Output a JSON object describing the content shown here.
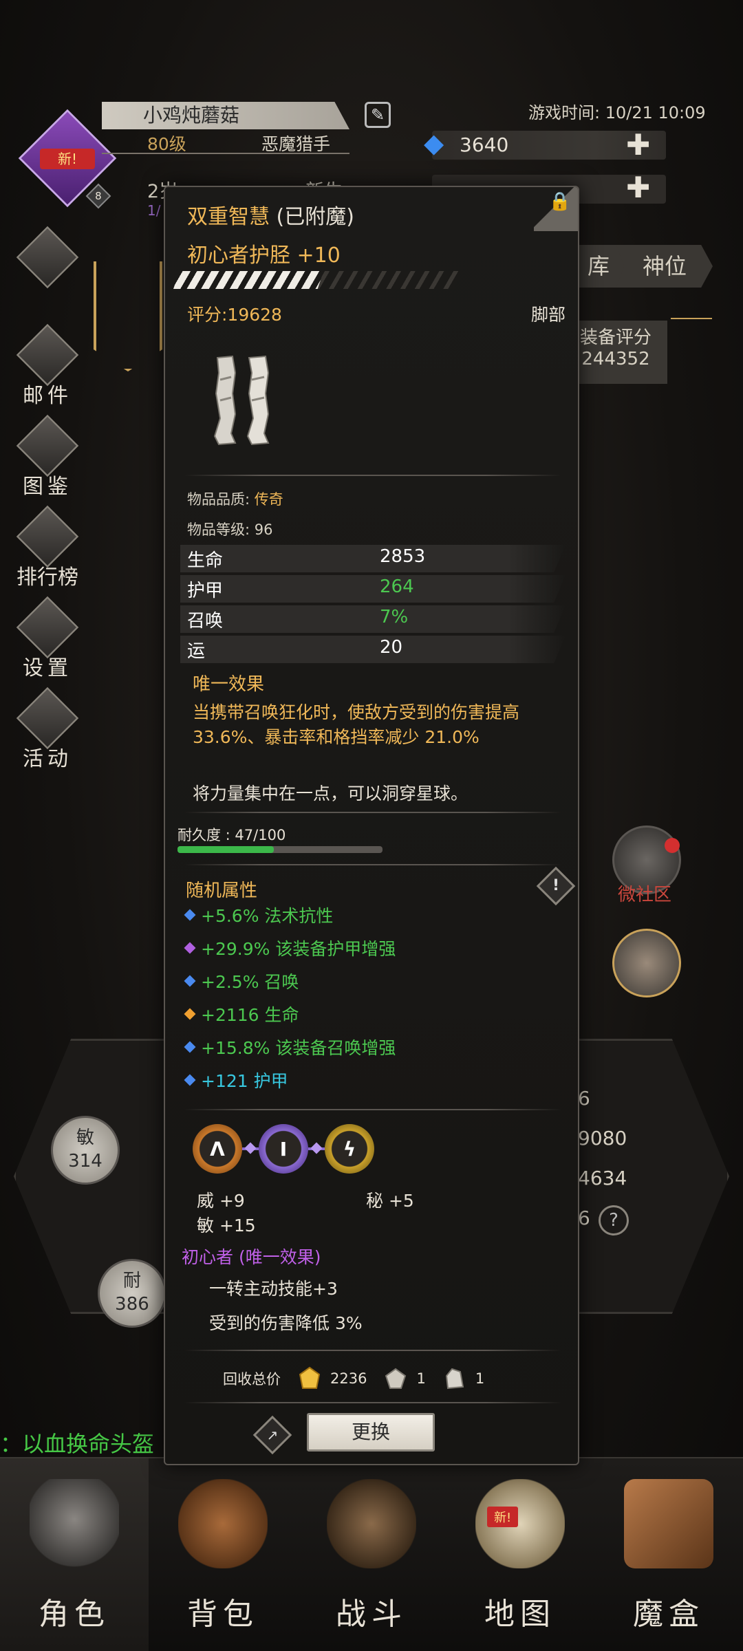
{
  "player": {
    "name": "小鸡炖蘑菇",
    "level": "80级",
    "class_name": "恶魔猎手",
    "row2_left": "2岁",
    "row2_right": "新生",
    "row2_sub": "1/",
    "avatar_badge": "新!",
    "avatar_level": "8"
  },
  "header": {
    "game_time": "游戏时间: 10/21 10:09",
    "gem_count": "3640"
  },
  "side_menu": [
    {
      "label": "邮件"
    },
    {
      "label": "图鉴"
    },
    {
      "label": "排行榜"
    },
    {
      "label": "设置"
    },
    {
      "label": "活动"
    }
  ],
  "tabs": {
    "warehouse": "库",
    "divine": "神位"
  },
  "equip_score": {
    "label": "装备评分",
    "value": "244352"
  },
  "stats_bg": {
    "agi": {
      "label": "敏",
      "value": "314"
    },
    "end": {
      "label": "耐",
      "value": "386"
    },
    "right_values": [
      "6",
      "9080",
      "4634",
      "6"
    ]
  },
  "social": {
    "label": "微社区"
  },
  "ticker": "：以血换命头盔",
  "item": {
    "enchant_title": "双重智慧",
    "enchant_suffix": "(已附魔)",
    "name": "初心者护胫 +10",
    "upgrade_fraction": 0.52,
    "score": "评分:19628",
    "slot": "脚部",
    "quality_label": "物品品质: ",
    "quality_value": "传奇",
    "item_level": "物品等级: 96",
    "base_stats": [
      {
        "key": "生命",
        "value": "2853",
        "green": false
      },
      {
        "key": "护甲",
        "value": "264",
        "green": true
      },
      {
        "key": "召唤",
        "value": "7%",
        "green": true
      },
      {
        "key": "运",
        "value": "20",
        "green": false
      }
    ],
    "unique_effect_title": "唯一效果",
    "unique_effect_desc": "当携带召唤狂化时，使敌方受到的伤害提高 33.6%、暴击率和格挡率减少 21.0%",
    "flavor_text": "将力量集中在一点，可以洞穿星球。",
    "durability_label": "耐久度 : 47/100",
    "durability_fraction": 0.47,
    "random_attr_title": "随机属性",
    "random_attrs": [
      {
        "text": "+5.6% 法术抗性",
        "gem_color": "#4a8af0",
        "cyan": false
      },
      {
        "text": "+29.9% 该装备护甲增强",
        "gem_color": "#b060e0",
        "cyan": false
      },
      {
        "text": "+2.5% 召唤",
        "gem_color": "#4a8af0",
        "cyan": false
      },
      {
        "text": "+2116 生命",
        "gem_color": "#f0a030",
        "cyan": false
      },
      {
        "text": "+15.8% 该装备召唤增强",
        "gem_color": "#4a8af0",
        "cyan": false
      },
      {
        "text": "+121 护甲",
        "gem_color": "#4a8af0",
        "cyan": true
      }
    ],
    "sockets": [
      {
        "glyph": "ᐱ",
        "ring": "#c9782a"
      },
      {
        "glyph": "Ⅰ",
        "ring": "#8a6ad0"
      },
      {
        "glyph": "ϟ",
        "ring": "#c9a02a"
      }
    ],
    "gem_stats": [
      {
        "label": "威 +9"
      },
      {
        "label": "秘 +5"
      },
      {
        "label": "敏 +15"
      }
    ],
    "set_title": "初心者 (唯一效果)",
    "set_effects": [
      "一转主动技能+3",
      "受到的伤害降低 3%"
    ],
    "recycle": {
      "label": "回收总价",
      "gold": "2236",
      "mat1": "1",
      "mat2": "1"
    },
    "swap_button": "更换"
  },
  "bottom_nav": [
    {
      "label": "角色",
      "active": true
    },
    {
      "label": "背包",
      "active": false
    },
    {
      "label": "战斗",
      "active": false
    },
    {
      "label": "地图",
      "active": false,
      "badge": "新!"
    },
    {
      "label": "魔盒",
      "active": false
    }
  ]
}
